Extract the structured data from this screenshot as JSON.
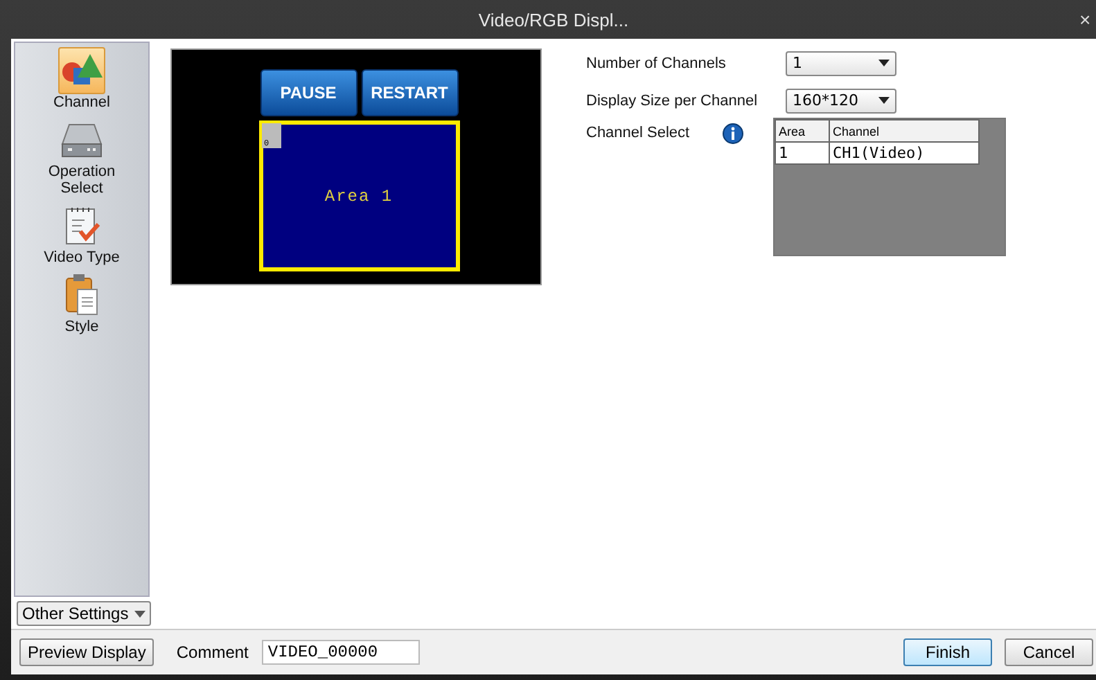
{
  "window": {
    "title": "Video/RGB Displ...",
    "close": "×"
  },
  "sidebar": {
    "items": [
      {
        "label": "Channel",
        "selected": true
      },
      {
        "label": "Operation Select",
        "selected": false
      },
      {
        "label": "Video Type",
        "selected": false
      },
      {
        "label": "Style",
        "selected": false
      }
    ],
    "other_settings": "Other Settings"
  },
  "preview": {
    "buttons": [
      "PAUSE",
      "RESTART"
    ],
    "area_label": "Area 1",
    "area_badge": "0"
  },
  "settings": {
    "fields": [
      {
        "label": "Number of Channels",
        "value": "1"
      },
      {
        "label": "Display Size per Channel",
        "value": "160*120"
      }
    ],
    "channel_select": {
      "label": "Channel Select",
      "table": {
        "columns": [
          "Area",
          "Channel"
        ],
        "rows": [
          [
            "1",
            "CH1(Video)"
          ]
        ]
      }
    }
  },
  "footer": {
    "preview_button": "Preview Display",
    "comment_label": "Comment",
    "comment_value": "VIDEO_00000",
    "buttons": [
      "Finish",
      "Cancel"
    ]
  }
}
